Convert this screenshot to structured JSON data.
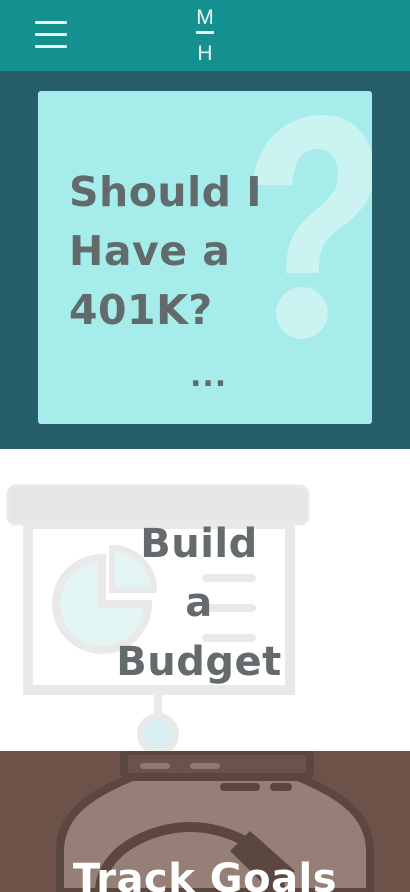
{
  "header": {
    "menu_icon": "hamburger-menu-icon",
    "logo": {
      "top": "M",
      "bottom": "H"
    }
  },
  "colors": {
    "header": "#14918e",
    "section_1_bg": "#265f69",
    "card_bg": "#a6eceb",
    "section_2_bg": "#ffffff",
    "section_3_bg": "#6c5249",
    "title_text": "#626b6c"
  },
  "sections": [
    {
      "title_lines": [
        "Should I",
        "Have a",
        "401K?"
      ],
      "more": "...",
      "icon": "question-mark-icon"
    },
    {
      "title_lines": [
        "Build",
        "a",
        "Budget"
      ],
      "icon": "presentation-chart-icon"
    },
    {
      "title": "Track Goals",
      "icon": "savings-jar-icon"
    }
  ]
}
